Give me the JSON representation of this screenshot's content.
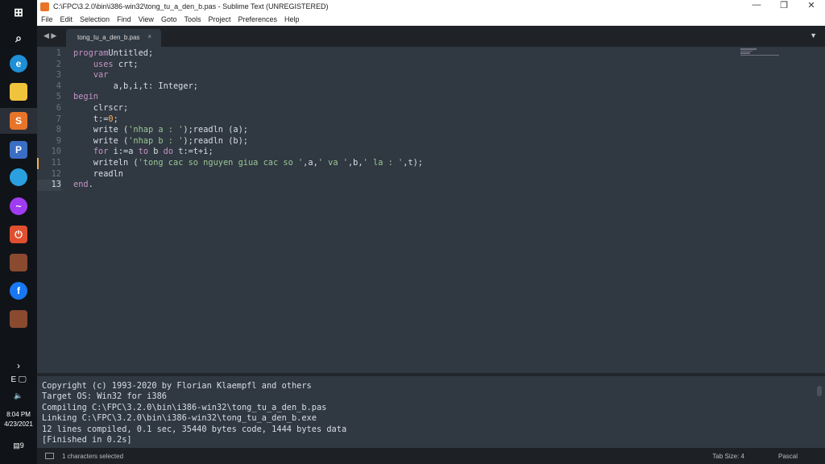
{
  "window": {
    "title": "C:\\FPC\\3.2.0\\bin\\i386-win32\\tong_tu_a_den_b.pas - Sublime Text (UNREGISTERED)",
    "minimize": "—",
    "maximize": "❐",
    "close": "✕"
  },
  "menu": [
    "File",
    "Edit",
    "Selection",
    "Find",
    "View",
    "Goto",
    "Tools",
    "Project",
    "Preferences",
    "Help"
  ],
  "tab": {
    "label": "tong_tu_a_den_b.pas",
    "close": "×"
  },
  "editor": {
    "lines": [
      [
        [
          "kw",
          "program"
        ],
        [
          "",
          "Untitled;"
        ]
      ],
      [
        [
          "",
          "    "
        ],
        [
          "kw",
          "uses"
        ],
        [
          "",
          " crt;"
        ]
      ],
      [
        [
          "",
          "    "
        ],
        [
          "kw",
          "var"
        ]
      ],
      [
        [
          "",
          "        a,b,i,t: Integer;"
        ]
      ],
      [
        [
          "kw",
          "begin"
        ]
      ],
      [
        [
          "",
          "    clrscr;"
        ]
      ],
      [
        [
          "",
          "    t:="
        ],
        [
          "num",
          "0"
        ],
        [
          "",
          ";"
        ]
      ],
      [
        [
          "",
          "    write ("
        ],
        [
          "str",
          "'nhap a : '"
        ],
        [
          "",
          ");readln (a);"
        ]
      ],
      [
        [
          "",
          "    write ("
        ],
        [
          "str",
          "'nhap b : '"
        ],
        [
          "",
          ");readln (b);"
        ]
      ],
      [
        [
          "",
          "    "
        ],
        [
          "kw",
          "for"
        ],
        [
          "",
          " i:=a "
        ],
        [
          "kw",
          "to"
        ],
        [
          "",
          " b "
        ],
        [
          "kw",
          "do"
        ],
        [
          "",
          " t:=t+i;"
        ]
      ],
      [
        [
          "",
          "    writeln ("
        ],
        [
          "str",
          "'tong cac so nguyen giua cac so '"
        ],
        [
          "",
          ",a,"
        ],
        [
          "str",
          "' va '"
        ],
        [
          "",
          ",b,"
        ],
        [
          "str",
          "' la : '"
        ],
        [
          "",
          ",t);"
        ]
      ],
      [
        [
          "",
          "    readln"
        ]
      ],
      [
        [
          "kw",
          "end"
        ],
        [
          "",
          "."
        ]
      ]
    ],
    "modified_line": 11,
    "current_line": 13
  },
  "console": {
    "lines": [
      "Copyright (c) 1993-2020 by Florian Klaempfl and others",
      "Target OS: Win32 for i386",
      "Compiling C:\\FPC\\3.2.0\\bin\\i386-win32\\tong_tu_a_den_b.pas",
      "Linking C:\\FPC\\3.2.0\\bin\\i386-win32\\tong_tu_a_den_b.exe",
      "12 lines compiled, 0.1 sec, 35440 bytes code, 1444 bytes data",
      "[Finished in 0.2s]"
    ]
  },
  "status": {
    "selection": "1 characters selected",
    "tab_size": "Tab Size: 4",
    "syntax": "Pascal"
  },
  "taskbar": {
    "time": "8:04 PM",
    "date": "4/23/2021",
    "lang": "E",
    "notifications": "9",
    "chevron": "›"
  }
}
